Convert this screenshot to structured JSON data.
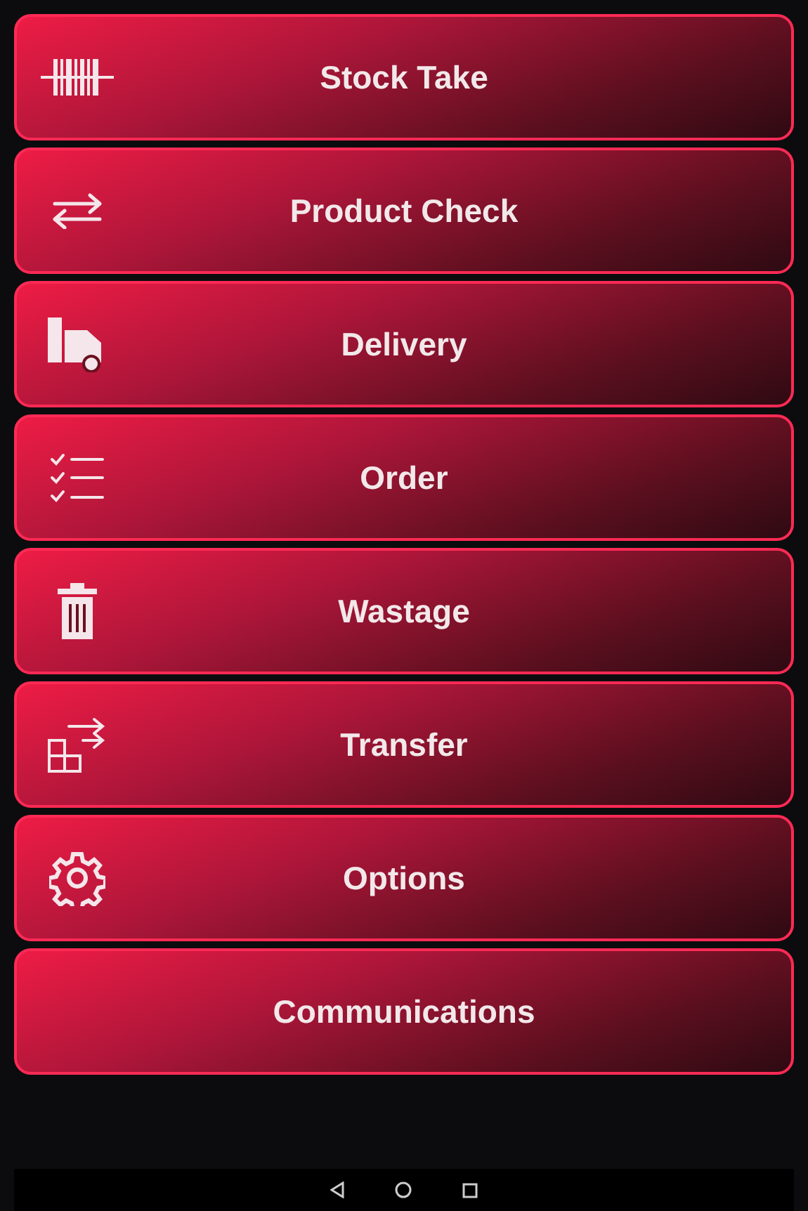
{
  "menu": [
    {
      "label": "Stock Take"
    },
    {
      "label": "Product Check"
    },
    {
      "label": "Delivery"
    },
    {
      "label": "Order"
    },
    {
      "label": "Wastage"
    },
    {
      "label": "Transfer"
    },
    {
      "label": "Options"
    },
    {
      "label": "Communications"
    }
  ]
}
